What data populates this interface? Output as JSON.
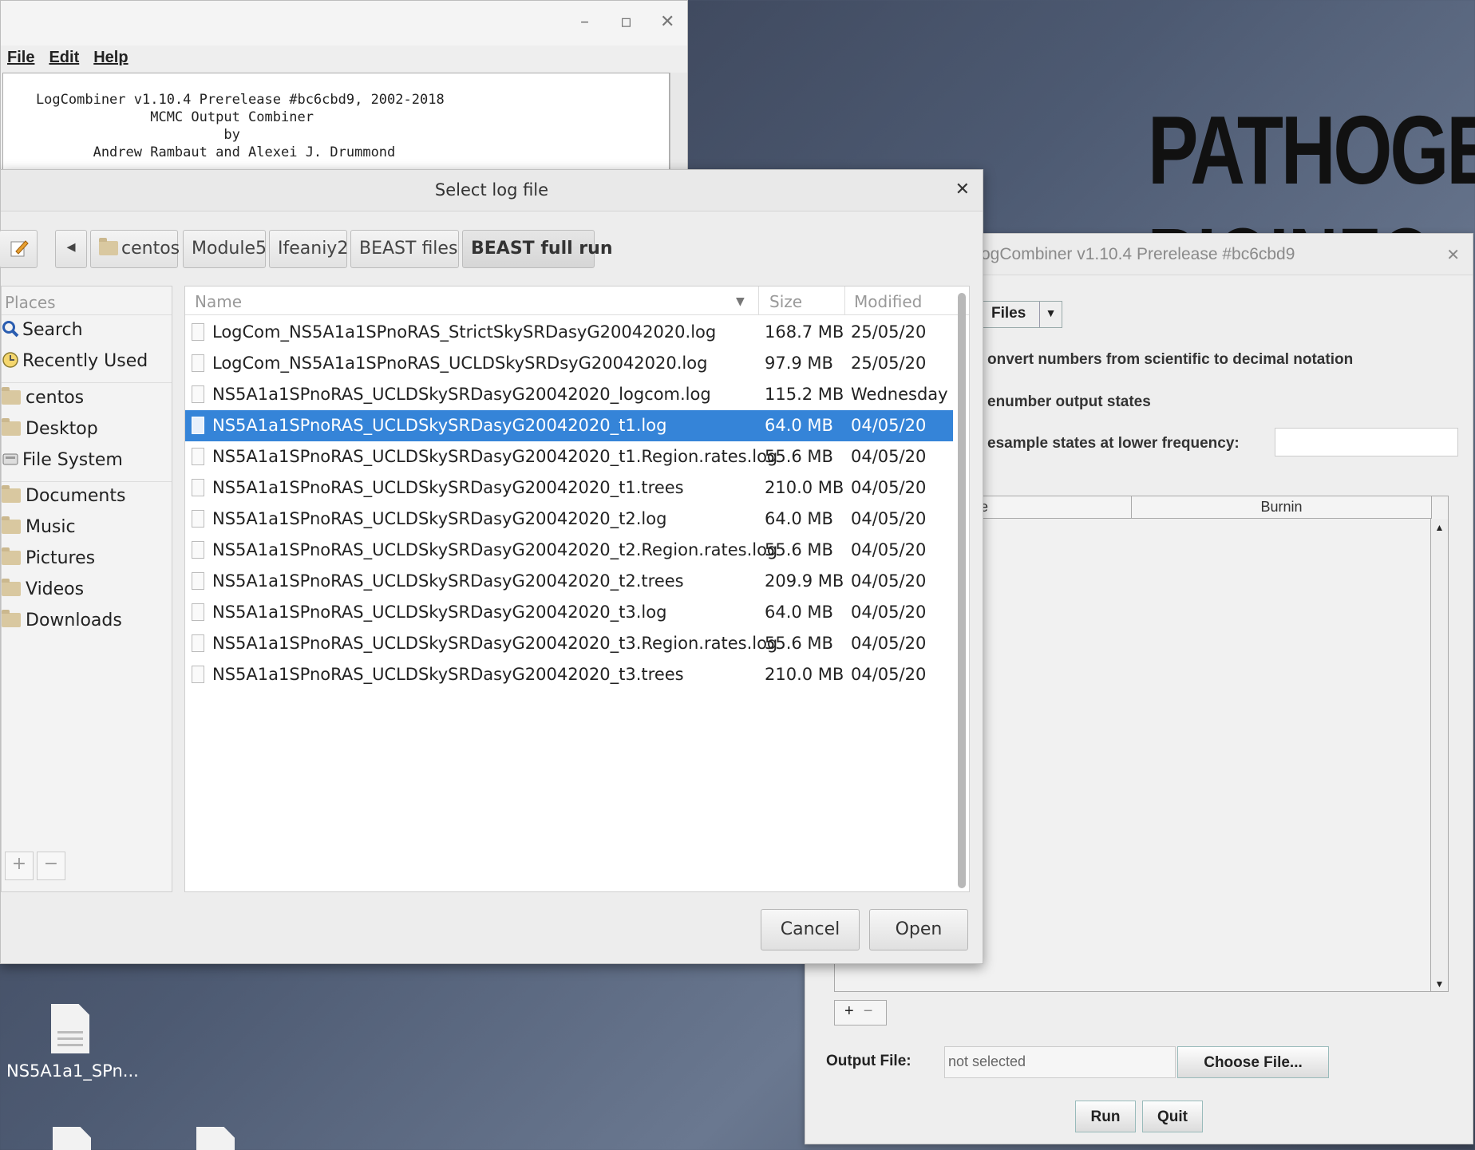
{
  "desktop": {
    "banner_text": "PATHOGE",
    "banner_text_2": "BIOINFO",
    "icons": [
      {
        "label": "NS5A1a1_SPn..."
      }
    ]
  },
  "main_window": {
    "controls": {
      "minimize": "–",
      "maximize": "▫",
      "close": "✕"
    },
    "menu": [
      {
        "label": "File"
      },
      {
        "label": "Edit"
      },
      {
        "label": "Help"
      }
    ],
    "console_lines": [
      "    LogCombiner v1.10.4 Prerelease #bc6cbd9, 2002-2018",
      "                  MCMC Output Combiner",
      "                           by",
      "           Andrew Rambaut and Alexei J. Drummond"
    ]
  },
  "settings_window": {
    "title": "ogCombiner v1.10.4 Prerelease #bc6cbd9",
    "close": "✕",
    "file_type_combo": "Files",
    "options": [
      "onvert numbers from scientific to decimal notation",
      "enumber output states",
      "esample states at lower frequency:"
    ],
    "table_headers": [
      "le",
      "Burnin"
    ],
    "add_label": "+",
    "remove_label": "−",
    "output_file_label": "Output File:",
    "output_file_value": "not selected",
    "choose_file_label": "Choose File...",
    "run_label": "Run",
    "quit_label": "Quit"
  },
  "file_dialog": {
    "title": "Select log file",
    "close": "✕",
    "back_arrow": "◂",
    "breadcrumbs": [
      "centos",
      "Module5",
      "Ifeaniy2",
      "BEAST files",
      "BEAST full run"
    ],
    "places_header": "Places",
    "places": [
      {
        "label": "Search",
        "icon": "search-icon"
      },
      {
        "label": "Recently Used",
        "icon": "clock-icon"
      },
      {
        "label": "centos",
        "icon": "folder-icon"
      },
      {
        "label": "Desktop",
        "icon": "folder-icon"
      },
      {
        "label": "File System",
        "icon": "drive-icon"
      },
      {
        "label": "Documents",
        "icon": "folder-icon"
      },
      {
        "label": "Music",
        "icon": "folder-icon"
      },
      {
        "label": "Pictures",
        "icon": "folder-icon"
      },
      {
        "label": "Videos",
        "icon": "folder-icon"
      },
      {
        "label": "Downloads",
        "icon": "folder-icon"
      }
    ],
    "columns": {
      "name": "Name",
      "size": "Size",
      "modified": "Modified"
    },
    "files": [
      {
        "name": "LogCom_NS5A1a1SPnoRAS_StrictSkySRDasyG20042020.log",
        "size": "168.7 MB",
        "modified": "25/05/20",
        "selected": false
      },
      {
        "name": "LogCom_NS5A1a1SPnoRAS_UCLDSkySRDsyG20042020.log",
        "size": "97.9 MB",
        "modified": "25/05/20",
        "selected": false
      },
      {
        "name": "NS5A1a1SPnoRAS_UCLDSkySRDasyG20042020_logcom.log",
        "size": "115.2 MB",
        "modified": "Wednesday",
        "selected": false
      },
      {
        "name": "NS5A1a1SPnoRAS_UCLDSkySRDasyG20042020_t1.log",
        "size": "64.0 MB",
        "modified": "04/05/20",
        "selected": true
      },
      {
        "name": "NS5A1a1SPnoRAS_UCLDSkySRDasyG20042020_t1.Region.rates.log",
        "size": "55.6 MB",
        "modified": "04/05/20",
        "selected": false
      },
      {
        "name": "NS5A1a1SPnoRAS_UCLDSkySRDasyG20042020_t1.trees",
        "size": "210.0 MB",
        "modified": "04/05/20",
        "selected": false
      },
      {
        "name": "NS5A1a1SPnoRAS_UCLDSkySRDasyG20042020_t2.log",
        "size": "64.0 MB",
        "modified": "04/05/20",
        "selected": false
      },
      {
        "name": "NS5A1a1SPnoRAS_UCLDSkySRDasyG20042020_t2.Region.rates.log",
        "size": "55.6 MB",
        "modified": "04/05/20",
        "selected": false
      },
      {
        "name": "NS5A1a1SPnoRAS_UCLDSkySRDasyG20042020_t2.trees",
        "size": "209.9 MB",
        "modified": "04/05/20",
        "selected": false
      },
      {
        "name": "NS5A1a1SPnoRAS_UCLDSkySRDasyG20042020_t3.log",
        "size": "64.0 MB",
        "modified": "04/05/20",
        "selected": false
      },
      {
        "name": "NS5A1a1SPnoRAS_UCLDSkySRDasyG20042020_t3.Region.rates.log",
        "size": "55.6 MB",
        "modified": "04/05/20",
        "selected": false
      },
      {
        "name": "NS5A1a1SPnoRAS_UCLDSkySRDasyG20042020_t3.trees",
        "size": "210.0 MB",
        "modified": "04/05/20",
        "selected": false
      }
    ],
    "places_add": "+",
    "places_remove": "−",
    "cancel_label": "Cancel",
    "open_label": "Open",
    "colors": {
      "selection": "#3584d8"
    }
  }
}
